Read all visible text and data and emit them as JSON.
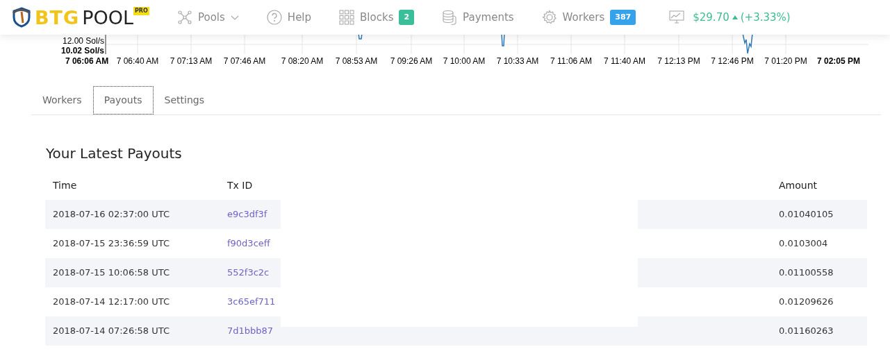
{
  "header": {
    "logo": {
      "text_1": "BTG",
      "text_2": "POOL",
      "tag": "PRO"
    },
    "nav": [
      {
        "kind": "dropdown",
        "label": "Pools"
      },
      {
        "kind": "link",
        "label": "Help"
      },
      {
        "kind": "badge",
        "label": "Blocks",
        "badge": "2",
        "color": "#3bbf9b"
      },
      {
        "kind": "link",
        "label": "Payments"
      },
      {
        "kind": "badge",
        "label": "Workers",
        "badge": "387",
        "color": "#36a2eb"
      }
    ],
    "price": {
      "value": "$29.70",
      "change": "(+3.33%)",
      "trend_up": true
    }
  },
  "hashrate_chart": {
    "y_labels": [
      "12.00 Sol/s",
      "10.02 Sol/s"
    ],
    "x_labels": [
      "7 06:06 AM",
      "7 06:40 AM",
      "7 07:13 AM",
      "7 07:46 AM",
      "7 08:20 AM",
      "7 08:53 AM",
      "7 09:26 AM",
      "7 10:00 AM",
      "7 10:33 AM",
      "7 11:06 AM",
      "7 11:40 AM",
      "7 12:13 PM",
      "7 12:46 PM",
      "7 01:20 PM",
      "7 02:05 PM"
    ]
  },
  "tabs": [
    {
      "label": "Workers",
      "selected": false
    },
    {
      "label": "Payouts",
      "selected": true
    },
    {
      "label": "Settings",
      "selected": false
    }
  ],
  "payouts": {
    "title": "Your Latest Payouts",
    "columns": [
      "Time",
      "Tx ID",
      "Amount"
    ],
    "rows": [
      {
        "time": "2018-07-16 02:37:00 UTC",
        "tx_id": "e9c3df3f",
        "amount": "0.01040105"
      },
      {
        "time": "2018-07-15 23:36:59 UTC",
        "tx_id": "f90d3ceff",
        "amount": "0.0103004"
      },
      {
        "time": "2018-07-15 10:06:58 UTC",
        "tx_id": "552f3c2c",
        "amount": "0.01100558"
      },
      {
        "time": "2018-07-14 12:17:00 UTC",
        "tx_id": "3c65ef711",
        "amount": "0.01209626"
      },
      {
        "time": "2018-07-14 07:26:58 UTC",
        "tx_id": "7d1bbb87",
        "amount": "0.01160263"
      }
    ]
  }
}
